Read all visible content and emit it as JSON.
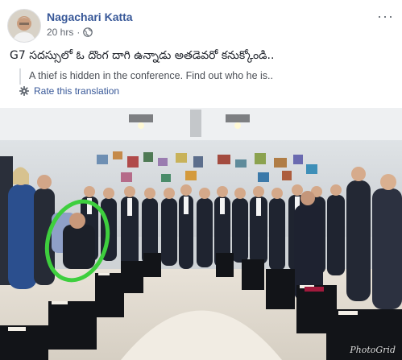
{
  "post": {
    "author": "Nagachari Katta",
    "timestamp": "20 hrs",
    "separator": "·",
    "privacy_icon": "globe-icon",
    "more_icon": "more-options-icon",
    "more_glyph": "···",
    "text": "G7 సదస్సులో ఓ దొంగ దాగి ఉన్నాడు అతడెవరో కనుక్కోండి..",
    "translation": "A thief is hidden in the conference. Find out who he is..",
    "rate_translation": "Rate this translation",
    "rate_icon": "gear-icon"
  },
  "photo": {
    "watermark": "PhotoGrid",
    "highlight_color": "#3ecf3e"
  },
  "colors": {
    "link": "#385898",
    "meta": "#616770",
    "text": "#1d2129"
  }
}
